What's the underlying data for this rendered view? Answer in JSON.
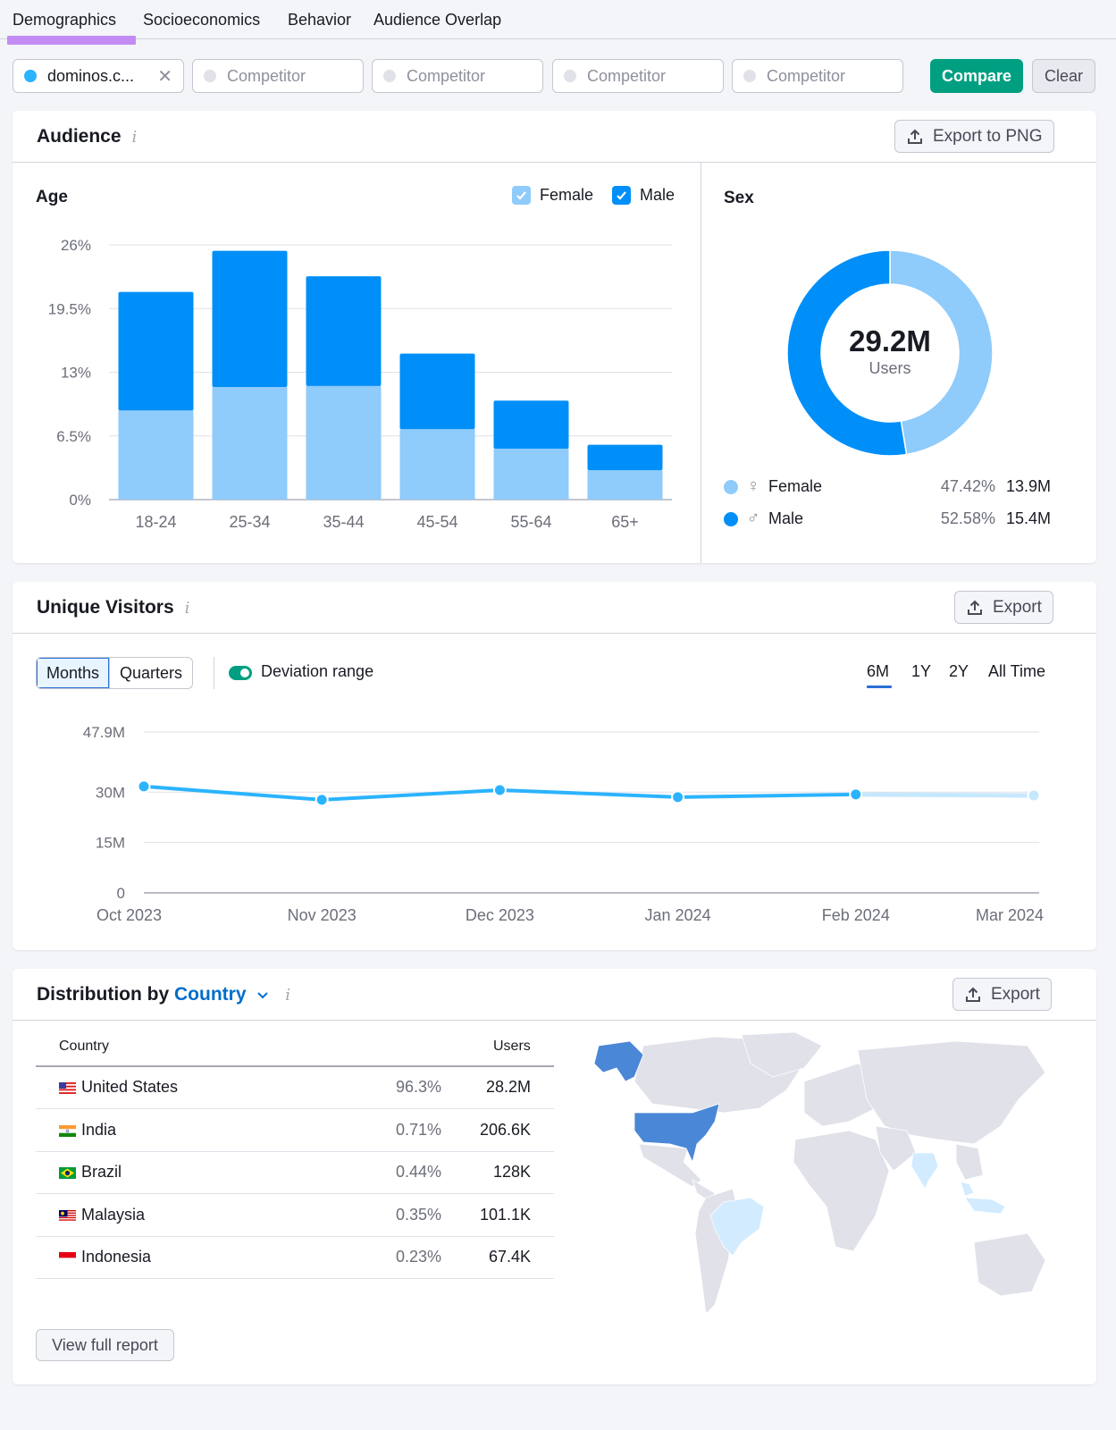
{
  "tabs": [
    {
      "label": "Demographics",
      "active": true
    },
    {
      "label": "Socioeconomics",
      "active": false
    },
    {
      "label": "Behavior",
      "active": false
    },
    {
      "label": "Audience Overlap",
      "active": false
    }
  ],
  "domains": {
    "main": {
      "value": "dominos.c...",
      "color": "#2bb3ff"
    },
    "competitor_placeholder": "Competitor",
    "competitors": [
      "Competitor",
      "Competitor",
      "Competitor",
      "Competitor"
    ],
    "compare_label": "Compare",
    "clear_label": "Clear"
  },
  "audience": {
    "title": "Audience",
    "export_label": "Export to PNG",
    "age": {
      "title": "Age",
      "legend": [
        {
          "label": "Female",
          "color": "#8fcbfb",
          "checked": true
        },
        {
          "label": "Male",
          "color": "#008ff8",
          "checked": true
        }
      ]
    },
    "sex": {
      "title": "Sex",
      "total_value": "29.2M",
      "total_label": "Users",
      "rows": [
        {
          "label": "Female",
          "symbol": "♀",
          "pct": "47.42%",
          "users": "13.9M",
          "color": "#8fcbfb"
        },
        {
          "label": "Male",
          "symbol": "♂",
          "pct": "52.58%",
          "users": "15.4M",
          "color": "#008ff8"
        }
      ]
    }
  },
  "unique_visitors": {
    "title": "Unique Visitors",
    "export_label": "Export",
    "granularity": [
      {
        "label": "Months",
        "active": true
      },
      {
        "label": "Quarters",
        "active": false
      }
    ],
    "deviation_toggle": {
      "label": "Deviation range",
      "on": true
    },
    "ranges": [
      {
        "label": "6M",
        "active": true
      },
      {
        "label": "1Y",
        "active": false
      },
      {
        "label": "2Y",
        "active": false
      },
      {
        "label": "All Time",
        "active": false
      }
    ]
  },
  "distribution": {
    "title_prefix": "Distribution by",
    "title_dropdown": "Country",
    "export_label": "Export",
    "columns": {
      "country": "Country",
      "users": "Users"
    },
    "rows": [
      {
        "country": "United States",
        "flag": "us",
        "pct": "96.3%",
        "users": "28.2M"
      },
      {
        "country": "India",
        "flag": "in",
        "pct": "0.71%",
        "users": "206.6K"
      },
      {
        "country": "Brazil",
        "flag": "br",
        "pct": "0.44%",
        "users": "128K"
      },
      {
        "country": "Malaysia",
        "flag": "my",
        "pct": "0.35%",
        "users": "101.1K"
      },
      {
        "country": "Indonesia",
        "flag": "id",
        "pct": "0.23%",
        "users": "67.4K"
      }
    ],
    "map_highlight": {
      "United States": "high",
      "India": "low",
      "Brazil": "low",
      "Malaysia": "low",
      "Indonesia": "low"
    },
    "map_colors": {
      "high": "#4a87d6",
      "low": "#d2ebff",
      "none": "#e0e1e9"
    },
    "view_full_label": "View full report"
  },
  "chart_data": [
    {
      "type": "bar",
      "stacked": true,
      "title": "Age",
      "categories": [
        "18-24",
        "25-34",
        "35-44",
        "45-54",
        "55-64",
        "65+"
      ],
      "series": [
        {
          "name": "Female",
          "color": "#8fcbfb",
          "values": [
            9.1,
            11.5,
            11.6,
            7.2,
            5.2,
            3.0
          ]
        },
        {
          "name": "Male",
          "color": "#008ff8",
          "values": [
            12.1,
            13.9,
            11.2,
            7.7,
            4.9,
            2.6
          ]
        }
      ],
      "yticks": [
        "0%",
        "6.5%",
        "13%",
        "19.5%",
        "26%"
      ],
      "ytick_values": [
        0,
        6.5,
        13,
        19.5,
        26
      ],
      "ylim": [
        0,
        26
      ],
      "xlabel": "",
      "ylabel": "",
      "grid": true,
      "legend": "top-right"
    },
    {
      "type": "pie",
      "donut": true,
      "title": "Sex",
      "categories": [
        "Female",
        "Male"
      ],
      "values": [
        47.42,
        52.58
      ],
      "colors": [
        "#8fcbfb",
        "#008ff8"
      ],
      "center_text": "29.2M Users"
    },
    {
      "type": "line",
      "title": "Unique Visitors",
      "x": [
        "Oct 2023",
        "Nov 2023",
        "Dec 2023",
        "Jan 2024",
        "Feb 2024",
        "Mar 2024"
      ],
      "series": [
        {
          "name": "Unique Visitors",
          "color": "#2bb3ff",
          "values": [
            31.7,
            27.7,
            30.6,
            28.5,
            29.3,
            29.0
          ],
          "projected_from_index": 4
        }
      ],
      "yticks": [
        "0",
        "15M",
        "30M",
        "47.9M"
      ],
      "ytick_values": [
        0,
        15,
        30,
        47.9
      ],
      "ylim": [
        0,
        47.9
      ],
      "yunit": "M",
      "grid": true
    }
  ]
}
